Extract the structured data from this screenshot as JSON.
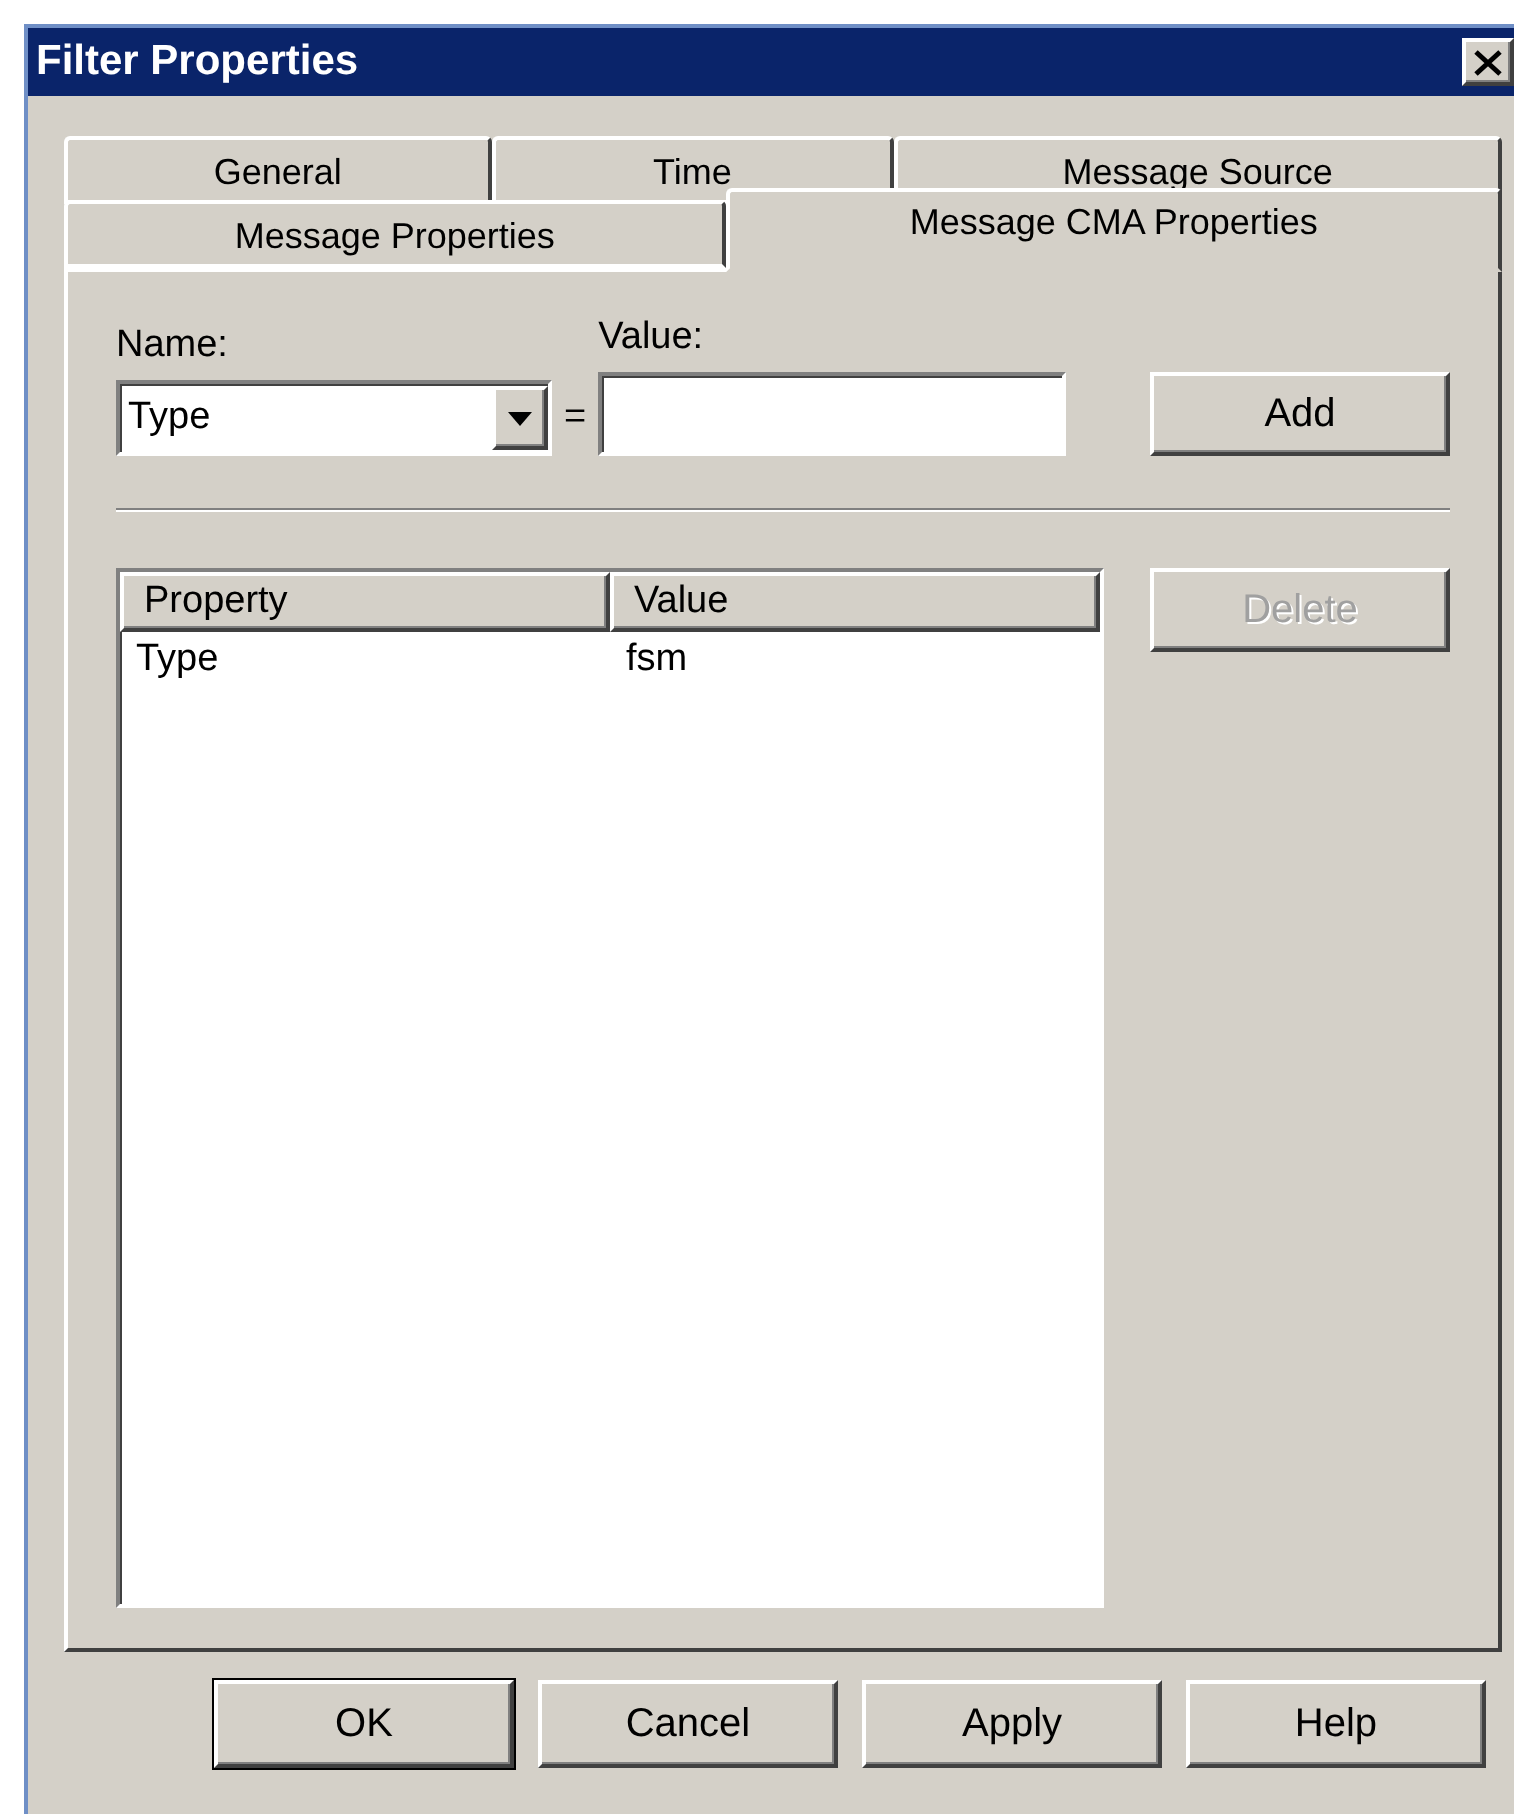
{
  "window": {
    "title": "Filter Properties"
  },
  "tab_rows": [
    [
      {
        "label": "General",
        "selected": false
      },
      {
        "label": "Time",
        "selected": false
      },
      {
        "label": "Message Source",
        "selected": false
      }
    ],
    [
      {
        "label": "Message Properties",
        "selected": false
      },
      {
        "label": "Message CMA Properties",
        "selected": true
      }
    ]
  ],
  "form": {
    "name_label": "Name:",
    "name_value": "Type",
    "equals": "=",
    "value_label": "Value:",
    "add_button": {
      "label": "Add",
      "disabled": false
    }
  },
  "table": {
    "columns": [
      "Property",
      "Value"
    ],
    "rows": [
      [
        "Type",
        "fsm"
      ]
    ]
  },
  "delete_button": {
    "label": "Delete",
    "disabled": true
  },
  "buttons": [
    {
      "label": "OK",
      "default": true
    },
    {
      "label": "Cancel",
      "default": false
    },
    {
      "label": "Apply",
      "default": false
    },
    {
      "label": "Help",
      "default": false
    }
  ]
}
